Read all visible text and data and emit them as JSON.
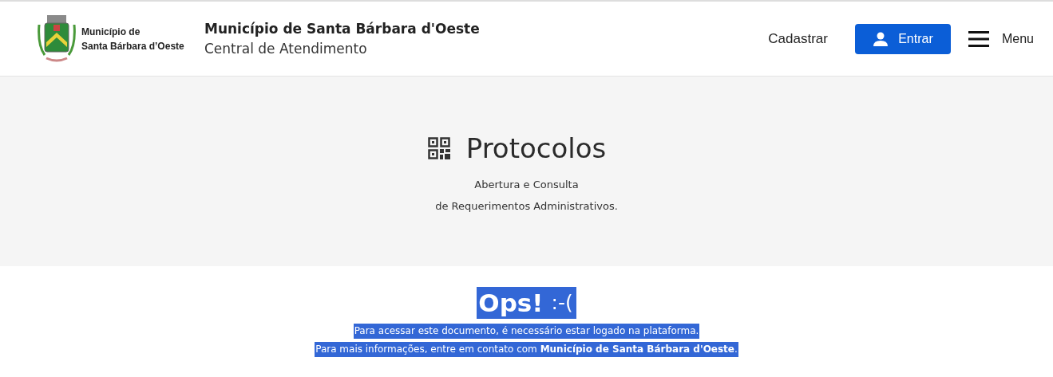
{
  "header": {
    "logo_text": [
      "Município de",
      "Santa Bárbara d’Oeste"
    ],
    "title": "Município de Santa Bárbara d'Oeste",
    "subtitle": "Central de Atendimento",
    "register_link": "Cadastrar",
    "login_button": "Entrar",
    "menu_button": "Menu"
  },
  "hero": {
    "title": "Protocolos",
    "description": [
      "Abertura e Consulta",
      "de Requerimentos Administrativos."
    ]
  },
  "message": {
    "title": "Ops!",
    "emoticon": ":-(",
    "lines": [
      "Para acessar este documento, é necessário estar logado na plataforma.",
      "Para mais informações, entre em contato com **Município de Santa Bárbara d'Oeste**."
    ]
  }
}
